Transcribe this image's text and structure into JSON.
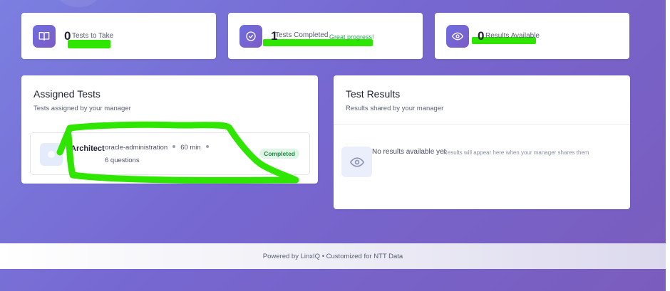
{
  "stats": [
    {
      "value": "0",
      "label": "Tests to Take",
      "icon": "book-icon"
    },
    {
      "value": "1",
      "label": "Tests Completed",
      "extra": "Great progress!",
      "icon": "check-circle-icon"
    },
    {
      "value": "0",
      "label": "Results Available",
      "icon": "eye-icon"
    }
  ],
  "assigned": {
    "title": "Assigned Tests",
    "subtitle": "Tests assigned by your manager",
    "items": [
      {
        "name": "Architect",
        "category": "oracle-administration",
        "duration": "60 min",
        "questions": "6 questions",
        "status": "Completed"
      }
    ]
  },
  "results": {
    "title": "Test Results",
    "subtitle": "Results shared by your manager",
    "empty_title": "No results available yet",
    "empty_subtitle": "Results will appear here when your manager shares them"
  },
  "footer": {
    "text": "Powered by LinxIQ • Customized for NTT Data"
  },
  "colors": {
    "accent": "#7367d6",
    "highlight": "#2ee600",
    "success": "#1f8a43"
  }
}
